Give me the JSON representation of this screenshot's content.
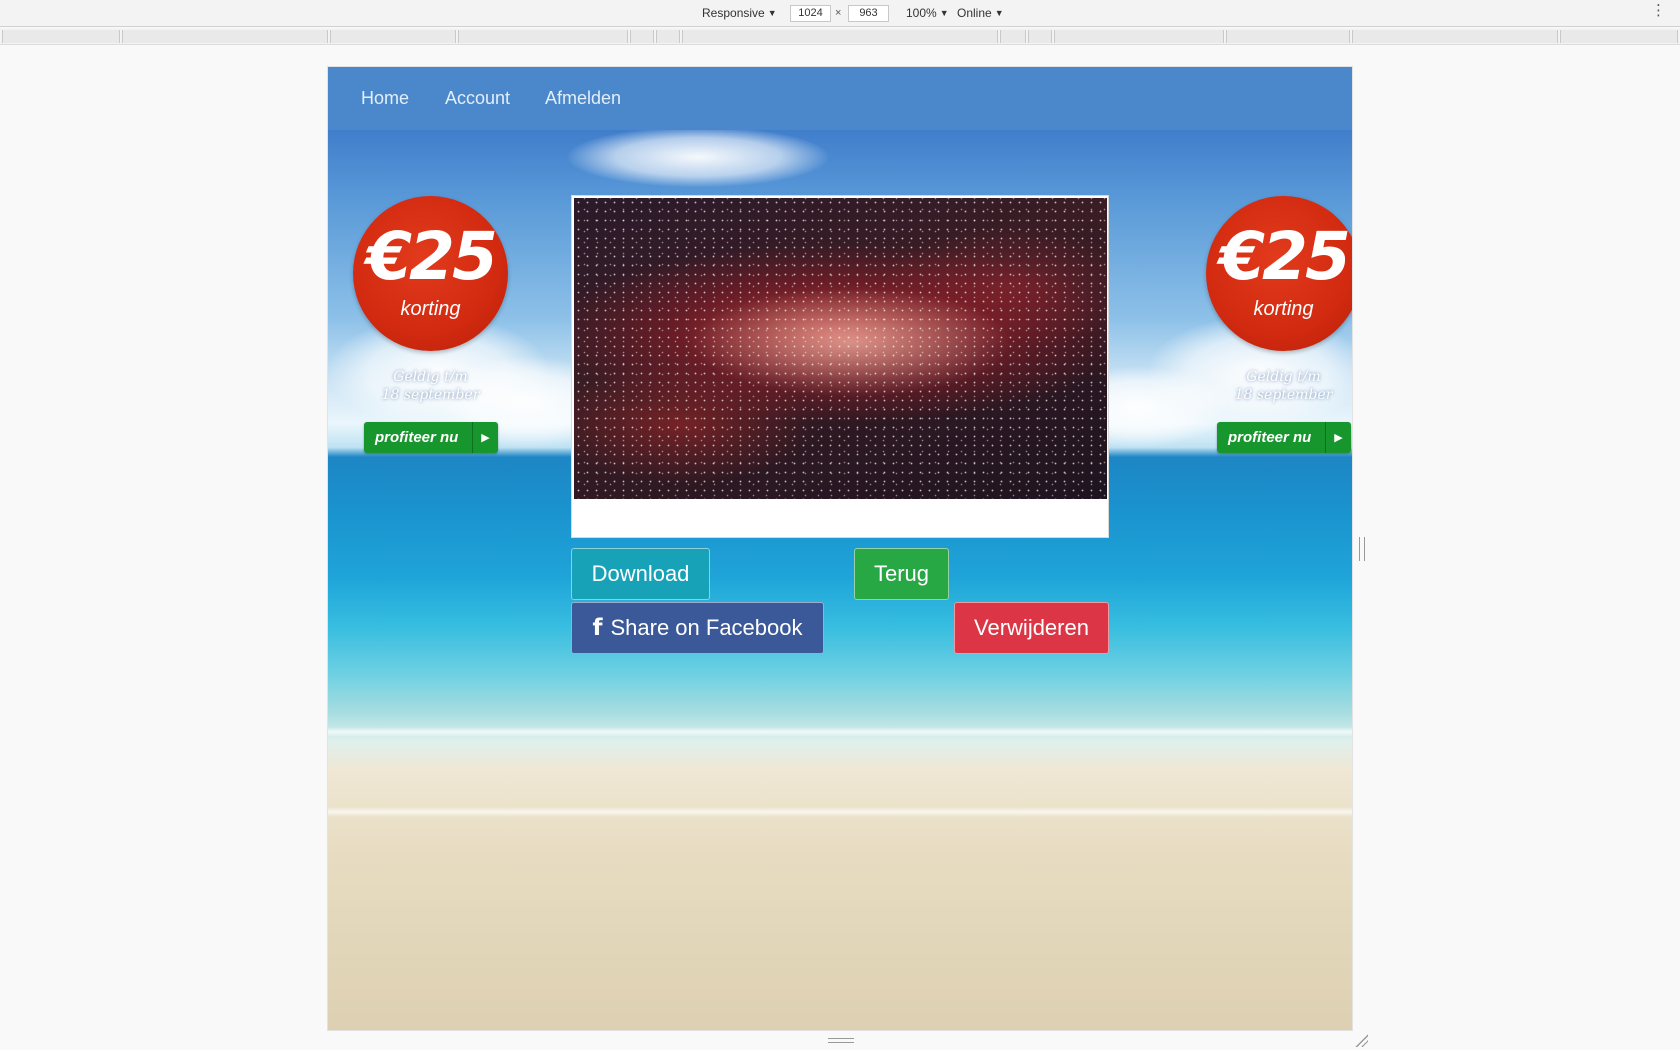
{
  "devtools": {
    "device_mode": "Responsive",
    "width": "1024",
    "times": "×",
    "height": "963",
    "zoom": "100%",
    "network": "Online",
    "more_icon": "kebab-menu-icon"
  },
  "nav": {
    "items": [
      {
        "label": "Home"
      },
      {
        "label": "Account"
      },
      {
        "label": "Afmelden"
      }
    ]
  },
  "promo": {
    "amount": "€25",
    "label": "korting",
    "valid_line1": "Geldig t/m",
    "valid_line2": "18 september",
    "cta": "profiteer nu"
  },
  "actions": {
    "download": "Download",
    "back": "Terug",
    "share": "Share on Facebook",
    "share_icon": "facebook-icon",
    "delete": "Verwijderen"
  },
  "colors": {
    "navbar": "#4a88cb",
    "download": "#17a2b8",
    "back": "#28a745",
    "share": "#3b5998",
    "delete": "#dc3545",
    "promo_badge": "#d12a10",
    "promo_cta": "#18962e"
  }
}
